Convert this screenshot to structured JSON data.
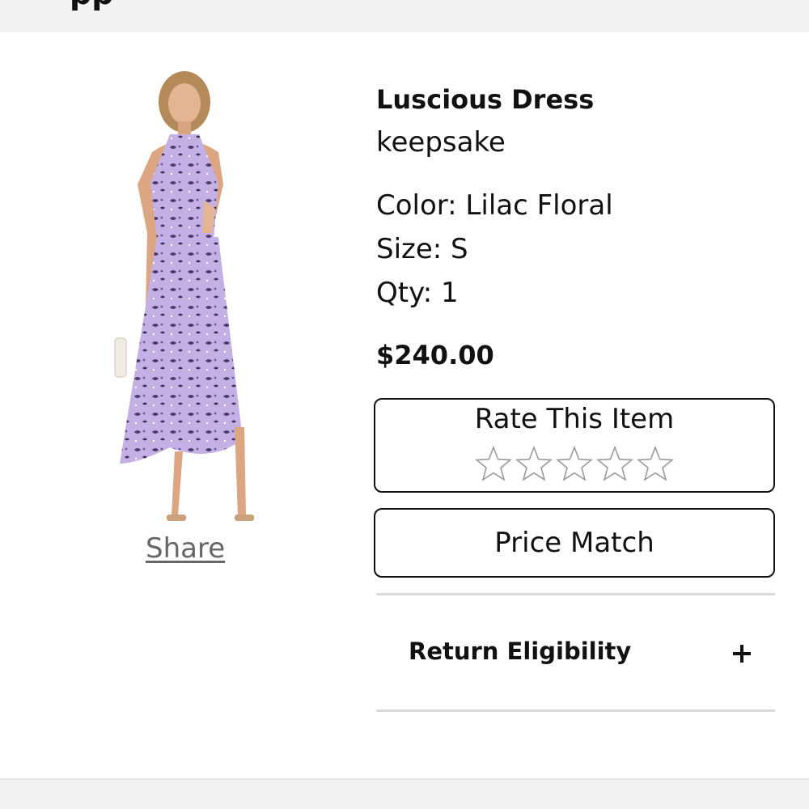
{
  "product": {
    "title": "Luscious Dress",
    "brand": "keepsake",
    "color": "Color: Lilac Floral",
    "size": "Size: S",
    "qty": "Qty: 1",
    "price": "$240.00",
    "image_icon": "dress-photo",
    "accent_color": "#c9b3e6"
  },
  "share": {
    "label": "Share"
  },
  "rating": {
    "title": "Rate This Item",
    "stars_total": 5,
    "stars_selected": 0
  },
  "price_match": {
    "label": "Price Match"
  },
  "return": {
    "label": "Return Eligibility",
    "toggle_icon": "plus-icon"
  }
}
